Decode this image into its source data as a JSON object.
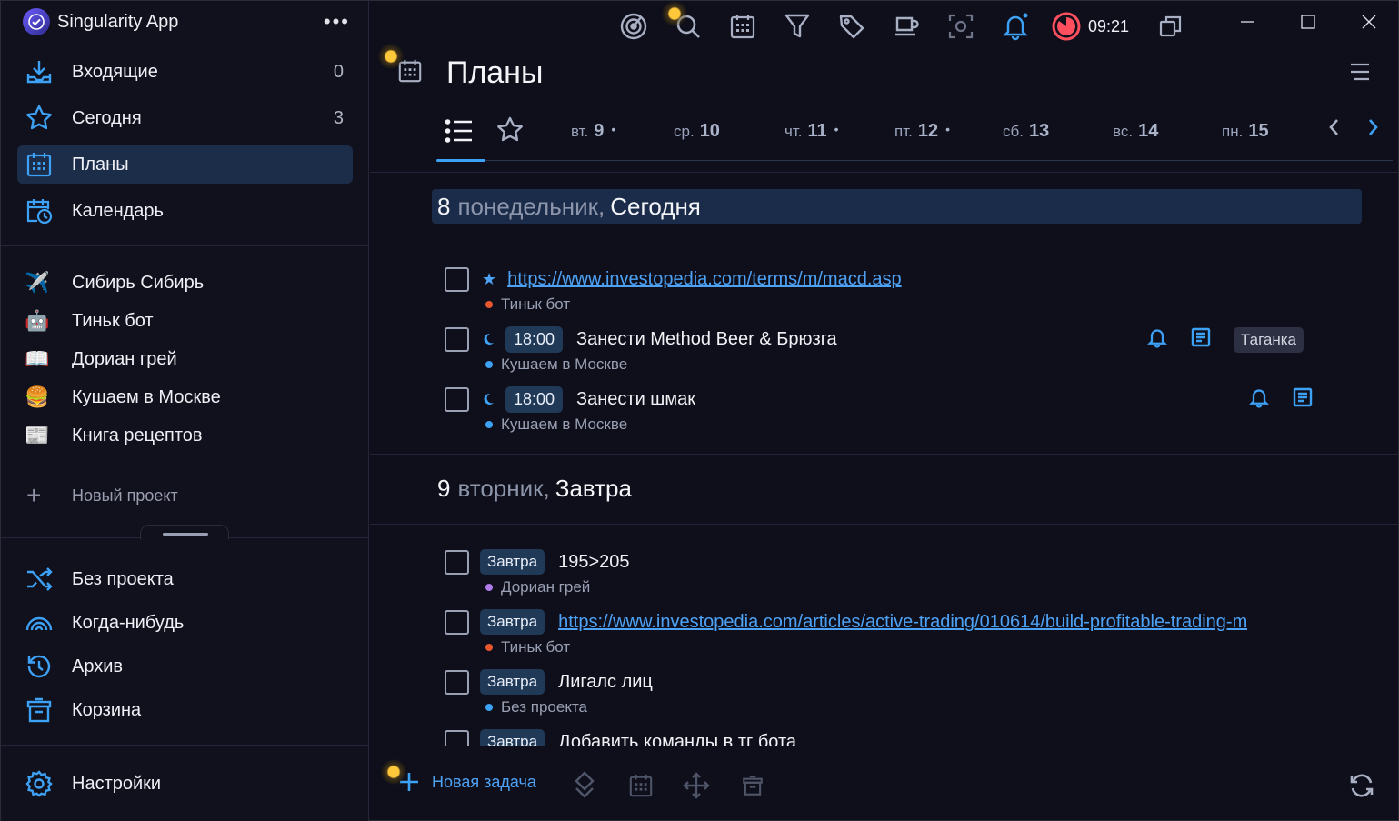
{
  "app": {
    "title": "Singularity App",
    "menu_label": "•••"
  },
  "sidebar": {
    "nav": [
      {
        "label": "Входящие",
        "count": "0"
      },
      {
        "label": "Сегодня",
        "count": "3"
      },
      {
        "label": "Планы",
        "count": ""
      },
      {
        "label": "Календарь",
        "count": ""
      }
    ],
    "projects": [
      {
        "label": "Сибирь Сибирь",
        "emoji": "✈️"
      },
      {
        "label": "Тиньк бот",
        "emoji": "🤖"
      },
      {
        "label": "Дориан грей",
        "emoji": "📖"
      },
      {
        "label": "Кушаем в Москве",
        "emoji": "🍔"
      },
      {
        "label": "Книга рецептов",
        "emoji": "📰"
      }
    ],
    "new_project": "Новый проект",
    "lists": [
      {
        "label": "Без проекта"
      },
      {
        "label": "Когда-нибудь"
      },
      {
        "label": "Архив"
      },
      {
        "label": "Корзина"
      }
    ],
    "settings": "Настройки"
  },
  "topbar": {
    "timer": "09:21"
  },
  "page": {
    "title": "Планы"
  },
  "day_tabs": [
    {
      "dow": "вт.",
      "num": "9",
      "dot": "•"
    },
    {
      "dow": "ср.",
      "num": "10",
      "dot": ""
    },
    {
      "dow": "чт.",
      "num": "11",
      "dot": "•"
    },
    {
      "dow": "пт.",
      "num": "12",
      "dot": "•"
    },
    {
      "dow": "сб.",
      "num": "13",
      "dot": ""
    },
    {
      "dow": "вс.",
      "num": "14",
      "dot": ""
    },
    {
      "dow": "пн.",
      "num": "15",
      "dot": ""
    }
  ],
  "sections": [
    {
      "num": "8",
      "dow": "понедельник,",
      "rel": "Сегодня",
      "tasks": [
        {
          "link": "https://www.investopedia.com/terms/m/macd.asp",
          "project": "Тиньк бот",
          "project_color": "#e8562e"
        },
        {
          "time": "18:00",
          "title": "Занести Method Beer & Брюзга",
          "project": "Кушаем в Москве",
          "project_color": "#3da1f5",
          "tag": "Таганка"
        },
        {
          "time": "18:00",
          "title": "Занести шмак",
          "project": "Кушаем в Москве",
          "project_color": "#3da1f5"
        }
      ]
    },
    {
      "num": "9",
      "dow": "вторник,",
      "rel": "Завтра",
      "tasks": [
        {
          "badge": "Завтра",
          "title": "195>205",
          "project": "Дориан грей",
          "project_color": "#b07be8"
        },
        {
          "badge": "Завтра",
          "link": "https://www.investopedia.com/articles/active-trading/010614/build-profitable-trading-m",
          "project": "Тиньк бот",
          "project_color": "#e8562e"
        },
        {
          "badge": "Завтра",
          "title": "Лигалс лиц",
          "project": "Без проекта",
          "project_color": "#3da1f5"
        },
        {
          "badge": "Завтра",
          "title": "Добавить команды в тг бота"
        }
      ]
    }
  ],
  "bottombar": {
    "new_task": "Новая задача"
  }
}
